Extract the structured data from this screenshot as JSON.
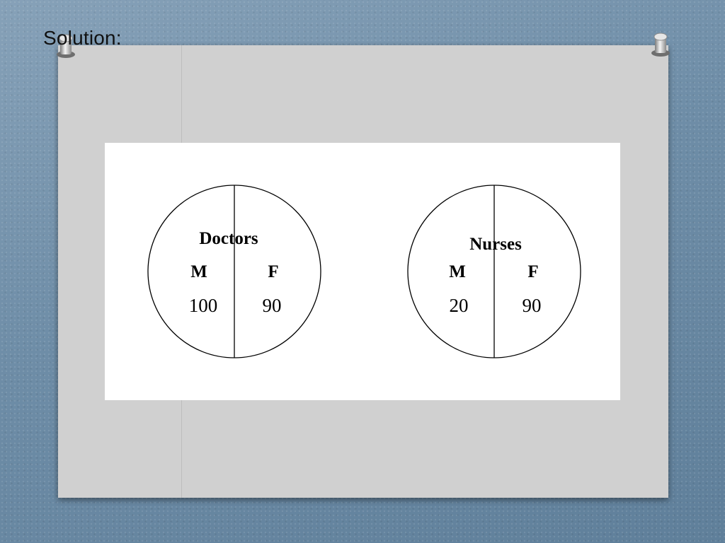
{
  "slide": {
    "title": "Solution:"
  },
  "diagram": {
    "circles": [
      {
        "title": "Doctors",
        "left_label": "M",
        "right_label": "F",
        "left_value": "100",
        "right_value": "90"
      },
      {
        "title": "Nurses",
        "left_label": "M",
        "right_label": "F",
        "left_value": "20",
        "right_value": "90"
      }
    ]
  },
  "colors": {
    "background": "#6f8ea8",
    "board": "#d0d0d0",
    "figure": "#ffffff",
    "ink": "#000000"
  }
}
